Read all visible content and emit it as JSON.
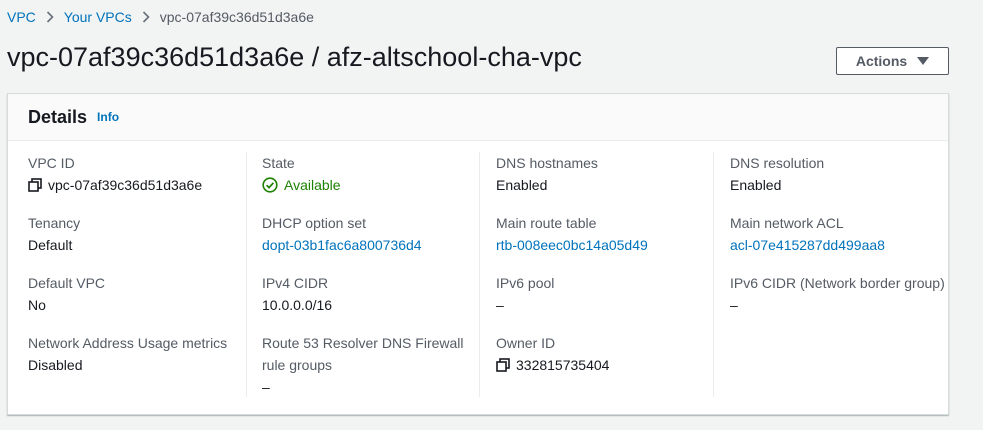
{
  "breadcrumb": {
    "items": [
      "VPC",
      "Your VPCs"
    ],
    "current": "vpc-07af39c36d51d3a6e"
  },
  "page": {
    "title": "vpc-07af39c36d51d3a6e / afz-altschool-cha-vpc",
    "actions_label": "Actions"
  },
  "details": {
    "title": "Details",
    "info_label": "Info",
    "columns": [
      [
        {
          "label": "VPC ID",
          "value": "vpc-07af39c36d51d3a6e"
        },
        {
          "label": "Tenancy",
          "value": "Default"
        },
        {
          "label": "Default VPC",
          "value": "No"
        },
        {
          "label": "Network Address Usage metrics",
          "value": "Disabled"
        }
      ],
      [
        {
          "label": "State",
          "value": "Available"
        },
        {
          "label": "DHCP option set",
          "value": "dopt-03b1fac6a800736d4"
        },
        {
          "label": "IPv4 CIDR",
          "value": "10.0.0.0/16"
        },
        {
          "label": "Route 53 Resolver DNS Firewall rule groups",
          "value": "–"
        }
      ],
      [
        {
          "label": "DNS hostnames",
          "value": "Enabled"
        },
        {
          "label": "Main route table",
          "value": "rtb-008eec0bc14a05d49"
        },
        {
          "label": "IPv6 pool",
          "value": "–"
        },
        {
          "label": "Owner ID",
          "value": "332815735404"
        }
      ],
      [
        {
          "label": "DNS resolution",
          "value": "Enabled"
        },
        {
          "label": "Main network ACL",
          "value": "acl-07e415287dd499aa8"
        },
        {
          "label": "IPv6 CIDR (Network border group)",
          "value": "–"
        }
      ]
    ]
  },
  "icons": {
    "copy": "copy-icon",
    "status_ok": "status-positive-icon",
    "breadcrumb_separator": "chevron-right-icon",
    "dropdown": "caret-down-icon"
  },
  "colors": {
    "link": "#0073bb",
    "success": "#1d8102",
    "text": "#16191f",
    "label": "#545b64",
    "background": "#f2f3f3"
  }
}
